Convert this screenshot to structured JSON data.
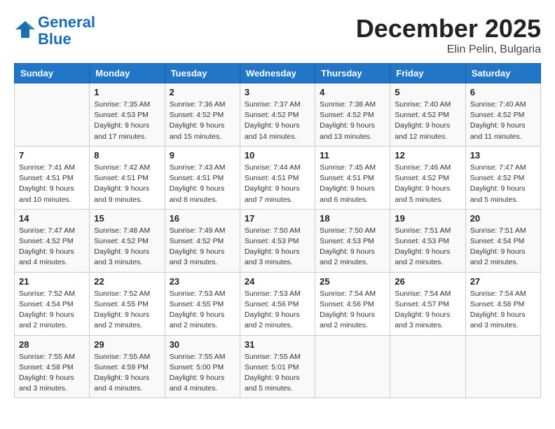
{
  "header": {
    "logo_line1": "General",
    "logo_line2": "Blue",
    "month": "December 2025",
    "location": "Elin Pelin, Bulgaria"
  },
  "days_of_week": [
    "Sunday",
    "Monday",
    "Tuesday",
    "Wednesday",
    "Thursday",
    "Friday",
    "Saturday"
  ],
  "weeks": [
    [
      {
        "day": "",
        "sunrise": "",
        "sunset": "",
        "daylight": ""
      },
      {
        "day": "1",
        "sunrise": "Sunrise: 7:35 AM",
        "sunset": "Sunset: 4:53 PM",
        "daylight": "Daylight: 9 hours and 17 minutes."
      },
      {
        "day": "2",
        "sunrise": "Sunrise: 7:36 AM",
        "sunset": "Sunset: 4:52 PM",
        "daylight": "Daylight: 9 hours and 15 minutes."
      },
      {
        "day": "3",
        "sunrise": "Sunrise: 7:37 AM",
        "sunset": "Sunset: 4:52 PM",
        "daylight": "Daylight: 9 hours and 14 minutes."
      },
      {
        "day": "4",
        "sunrise": "Sunrise: 7:38 AM",
        "sunset": "Sunset: 4:52 PM",
        "daylight": "Daylight: 9 hours and 13 minutes."
      },
      {
        "day": "5",
        "sunrise": "Sunrise: 7:40 AM",
        "sunset": "Sunset: 4:52 PM",
        "daylight": "Daylight: 9 hours and 12 minutes."
      },
      {
        "day": "6",
        "sunrise": "Sunrise: 7:40 AM",
        "sunset": "Sunset: 4:52 PM",
        "daylight": "Daylight: 9 hours and 11 minutes."
      }
    ],
    [
      {
        "day": "7",
        "sunrise": "Sunrise: 7:41 AM",
        "sunset": "Sunset: 4:51 PM",
        "daylight": "Daylight: 9 hours and 10 minutes."
      },
      {
        "day": "8",
        "sunrise": "Sunrise: 7:42 AM",
        "sunset": "Sunset: 4:51 PM",
        "daylight": "Daylight: 9 hours and 9 minutes."
      },
      {
        "day": "9",
        "sunrise": "Sunrise: 7:43 AM",
        "sunset": "Sunset: 4:51 PM",
        "daylight": "Daylight: 9 hours and 8 minutes."
      },
      {
        "day": "10",
        "sunrise": "Sunrise: 7:44 AM",
        "sunset": "Sunset: 4:51 PM",
        "daylight": "Daylight: 9 hours and 7 minutes."
      },
      {
        "day": "11",
        "sunrise": "Sunrise: 7:45 AM",
        "sunset": "Sunset: 4:51 PM",
        "daylight": "Daylight: 9 hours and 6 minutes."
      },
      {
        "day": "12",
        "sunrise": "Sunrise: 7:46 AM",
        "sunset": "Sunset: 4:52 PM",
        "daylight": "Daylight: 9 hours and 5 minutes."
      },
      {
        "day": "13",
        "sunrise": "Sunrise: 7:47 AM",
        "sunset": "Sunset: 4:52 PM",
        "daylight": "Daylight: 9 hours and 5 minutes."
      }
    ],
    [
      {
        "day": "14",
        "sunrise": "Sunrise: 7:47 AM",
        "sunset": "Sunset: 4:52 PM",
        "daylight": "Daylight: 9 hours and 4 minutes."
      },
      {
        "day": "15",
        "sunrise": "Sunrise: 7:48 AM",
        "sunset": "Sunset: 4:52 PM",
        "daylight": "Daylight: 9 hours and 3 minutes."
      },
      {
        "day": "16",
        "sunrise": "Sunrise: 7:49 AM",
        "sunset": "Sunset: 4:52 PM",
        "daylight": "Daylight: 9 hours and 3 minutes."
      },
      {
        "day": "17",
        "sunrise": "Sunrise: 7:50 AM",
        "sunset": "Sunset: 4:53 PM",
        "daylight": "Daylight: 9 hours and 3 minutes."
      },
      {
        "day": "18",
        "sunrise": "Sunrise: 7:50 AM",
        "sunset": "Sunset: 4:53 PM",
        "daylight": "Daylight: 9 hours and 2 minutes."
      },
      {
        "day": "19",
        "sunrise": "Sunrise: 7:51 AM",
        "sunset": "Sunset: 4:53 PM",
        "daylight": "Daylight: 9 hours and 2 minutes."
      },
      {
        "day": "20",
        "sunrise": "Sunrise: 7:51 AM",
        "sunset": "Sunset: 4:54 PM",
        "daylight": "Daylight: 9 hours and 2 minutes."
      }
    ],
    [
      {
        "day": "21",
        "sunrise": "Sunrise: 7:52 AM",
        "sunset": "Sunset: 4:54 PM",
        "daylight": "Daylight: 9 hours and 2 minutes."
      },
      {
        "day": "22",
        "sunrise": "Sunrise: 7:52 AM",
        "sunset": "Sunset: 4:55 PM",
        "daylight": "Daylight: 9 hours and 2 minutes."
      },
      {
        "day": "23",
        "sunrise": "Sunrise: 7:53 AM",
        "sunset": "Sunset: 4:55 PM",
        "daylight": "Daylight: 9 hours and 2 minutes."
      },
      {
        "day": "24",
        "sunrise": "Sunrise: 7:53 AM",
        "sunset": "Sunset: 4:56 PM",
        "daylight": "Daylight: 9 hours and 2 minutes."
      },
      {
        "day": "25",
        "sunrise": "Sunrise: 7:54 AM",
        "sunset": "Sunset: 4:56 PM",
        "daylight": "Daylight: 9 hours and 2 minutes."
      },
      {
        "day": "26",
        "sunrise": "Sunrise: 7:54 AM",
        "sunset": "Sunset: 4:57 PM",
        "daylight": "Daylight: 9 hours and 3 minutes."
      },
      {
        "day": "27",
        "sunrise": "Sunrise: 7:54 AM",
        "sunset": "Sunset: 4:58 PM",
        "daylight": "Daylight: 9 hours and 3 minutes."
      }
    ],
    [
      {
        "day": "28",
        "sunrise": "Sunrise: 7:55 AM",
        "sunset": "Sunset: 4:58 PM",
        "daylight": "Daylight: 9 hours and 3 minutes."
      },
      {
        "day": "29",
        "sunrise": "Sunrise: 7:55 AM",
        "sunset": "Sunset: 4:59 PM",
        "daylight": "Daylight: 9 hours and 4 minutes."
      },
      {
        "day": "30",
        "sunrise": "Sunrise: 7:55 AM",
        "sunset": "Sunset: 5:00 PM",
        "daylight": "Daylight: 9 hours and 4 minutes."
      },
      {
        "day": "31",
        "sunrise": "Sunrise: 7:55 AM",
        "sunset": "Sunset: 5:01 PM",
        "daylight": "Daylight: 9 hours and 5 minutes."
      },
      {
        "day": "",
        "sunrise": "",
        "sunset": "",
        "daylight": ""
      },
      {
        "day": "",
        "sunrise": "",
        "sunset": "",
        "daylight": ""
      },
      {
        "day": "",
        "sunrise": "",
        "sunset": "",
        "daylight": ""
      }
    ]
  ]
}
